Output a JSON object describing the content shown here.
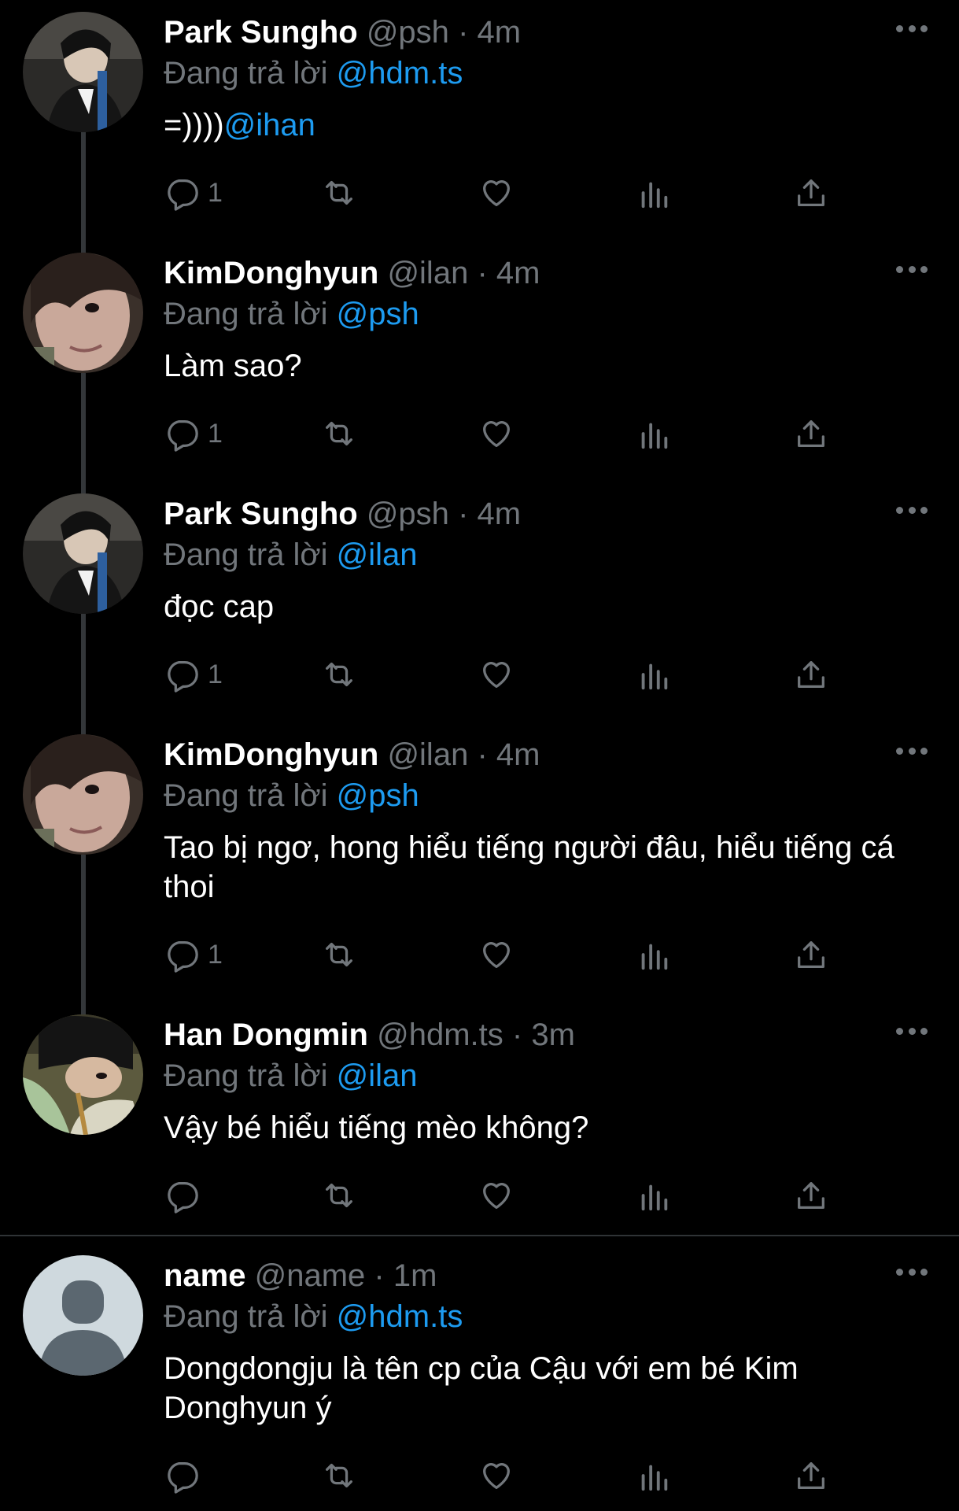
{
  "reply_prefix": "Đang trả lời",
  "colors": {
    "background": "#000000",
    "accent": "#1d9bf0",
    "muted": "#71767b"
  },
  "tweets": [
    {
      "name": "Park Sungho",
      "handle": "@psh",
      "dot": "·",
      "time": "4m",
      "reply_to": "@hdm.ts",
      "text_plain": "=))))",
      "text_mention": "@ihan",
      "reply_count": "1",
      "avatar": "photo-avatar-park-sungho"
    },
    {
      "name": "KimDonghyun",
      "handle": "@ilan",
      "dot": "·",
      "time": "4m",
      "reply_to": "@psh",
      "text_plain": "Làm sao?",
      "text_mention": "",
      "reply_count": "1",
      "avatar": "photo-avatar-kimdonghyun"
    },
    {
      "name": "Park Sungho",
      "handle": "@psh",
      "dot": "·",
      "time": "4m",
      "reply_to": "@ilan",
      "text_plain": "đọc cap",
      "text_mention": "",
      "reply_count": "1",
      "avatar": "photo-avatar-park-sungho"
    },
    {
      "name": "KimDonghyun",
      "handle": "@ilan",
      "dot": "·",
      "time": "4m",
      "reply_to": "@psh",
      "text_plain": "Tao bị ngơ, hong hiểu tiếng người đâu, hiểu tiếng cá thoi",
      "text_mention": "",
      "reply_count": "1",
      "avatar": "photo-avatar-kimdonghyun"
    },
    {
      "name": "Han Dongmin",
      "handle": "@hdm.ts",
      "dot": "·",
      "time": "3m",
      "reply_to": "@ilan",
      "text_plain": "Vậy bé hiểu tiếng mèo không?",
      "text_mention": "",
      "reply_count": "",
      "avatar": "photo-avatar-han-dongmin"
    },
    {
      "name": "name",
      "handle": "@name",
      "dot": "·",
      "time": "1m",
      "reply_to": "@hdm.ts",
      "text_plain": "Dongdongju là tên cp của Cậu với em bé Kim Donghyun ý",
      "text_mention": "",
      "reply_count": "",
      "avatar": "default-avatar-placeholder"
    }
  ],
  "icons": [
    "reply-icon",
    "retweet-icon",
    "like-icon",
    "views-icon",
    "share-icon",
    "more-icon"
  ]
}
